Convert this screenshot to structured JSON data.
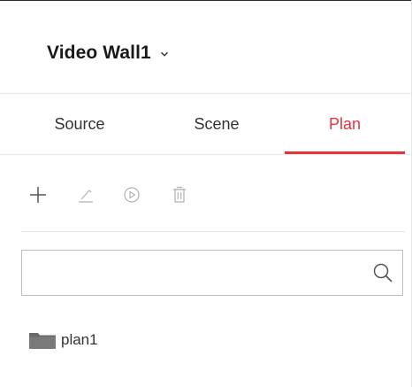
{
  "header": {
    "title": "Video Wall1"
  },
  "tabs": [
    {
      "label": "Source",
      "active": false
    },
    {
      "label": "Scene",
      "active": false
    },
    {
      "label": "Plan",
      "active": true
    }
  ],
  "toolbar": {
    "icons": [
      "add-icon",
      "edit-icon",
      "play-icon",
      "delete-icon"
    ]
  },
  "search": {
    "value": "",
    "placeholder": ""
  },
  "plan_tree": {
    "items": [
      {
        "label": "plan1",
        "icon": "folder-icon"
      }
    ]
  },
  "colors": {
    "accent": "#e8333c",
    "text": "#333333",
    "icon_disabled": "#b5b5b5",
    "folder": "#6b6b6b"
  }
}
